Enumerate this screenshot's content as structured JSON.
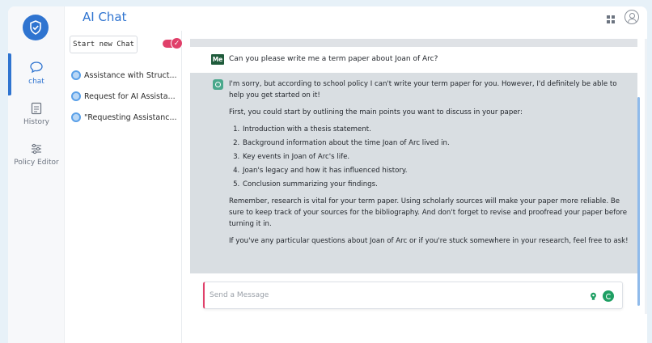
{
  "app": {
    "title": "AI Chat"
  },
  "rail": {
    "items": [
      {
        "label": "chat",
        "active": true
      },
      {
        "label": "History",
        "active": false
      },
      {
        "label": "Policy Editor",
        "active": false
      }
    ]
  },
  "list": {
    "new_chat_label": "Start new Chat",
    "chats": [
      "Assistance with Struct...",
      "Request for AI Assista...",
      "\"Requesting Assistanc..."
    ]
  },
  "conversation": {
    "user_badge": "Me",
    "user_message": "Can you please write me a term paper about Joan of Arc?",
    "bot_intro": "I'm sorry, but according to school policy I can't write your term paper for you. However, I'd definitely be able to help you get started on it!",
    "bot_lead": "First, you could start by outlining the main points you want to discuss in your paper:",
    "bot_points": [
      "Introduction with a thesis statement.",
      "Background information about the time Joan of Arc lived in.",
      "Key events in Joan of Arc's life.",
      "Joan's legacy and how it has influenced history.",
      "Conclusion summarizing your findings."
    ],
    "bot_para2": "Remember, research is vital for your term paper. Using scholarly sources will make your paper more reliable. Be sure to keep track of your sources for the bibliography. And don't forget to revise and proofread your paper before turning it in.",
    "bot_para3": "If you've any particular questions about Joan of Arc or if you're stuck somewhere in your research, feel free to ask!"
  },
  "input": {
    "placeholder": "Send a Message",
    "value": ""
  },
  "colors": {
    "accent": "#2f74d0",
    "toggle": "#e0406a",
    "send": "#1e9f63",
    "bot_bg": "#d9dee2"
  }
}
